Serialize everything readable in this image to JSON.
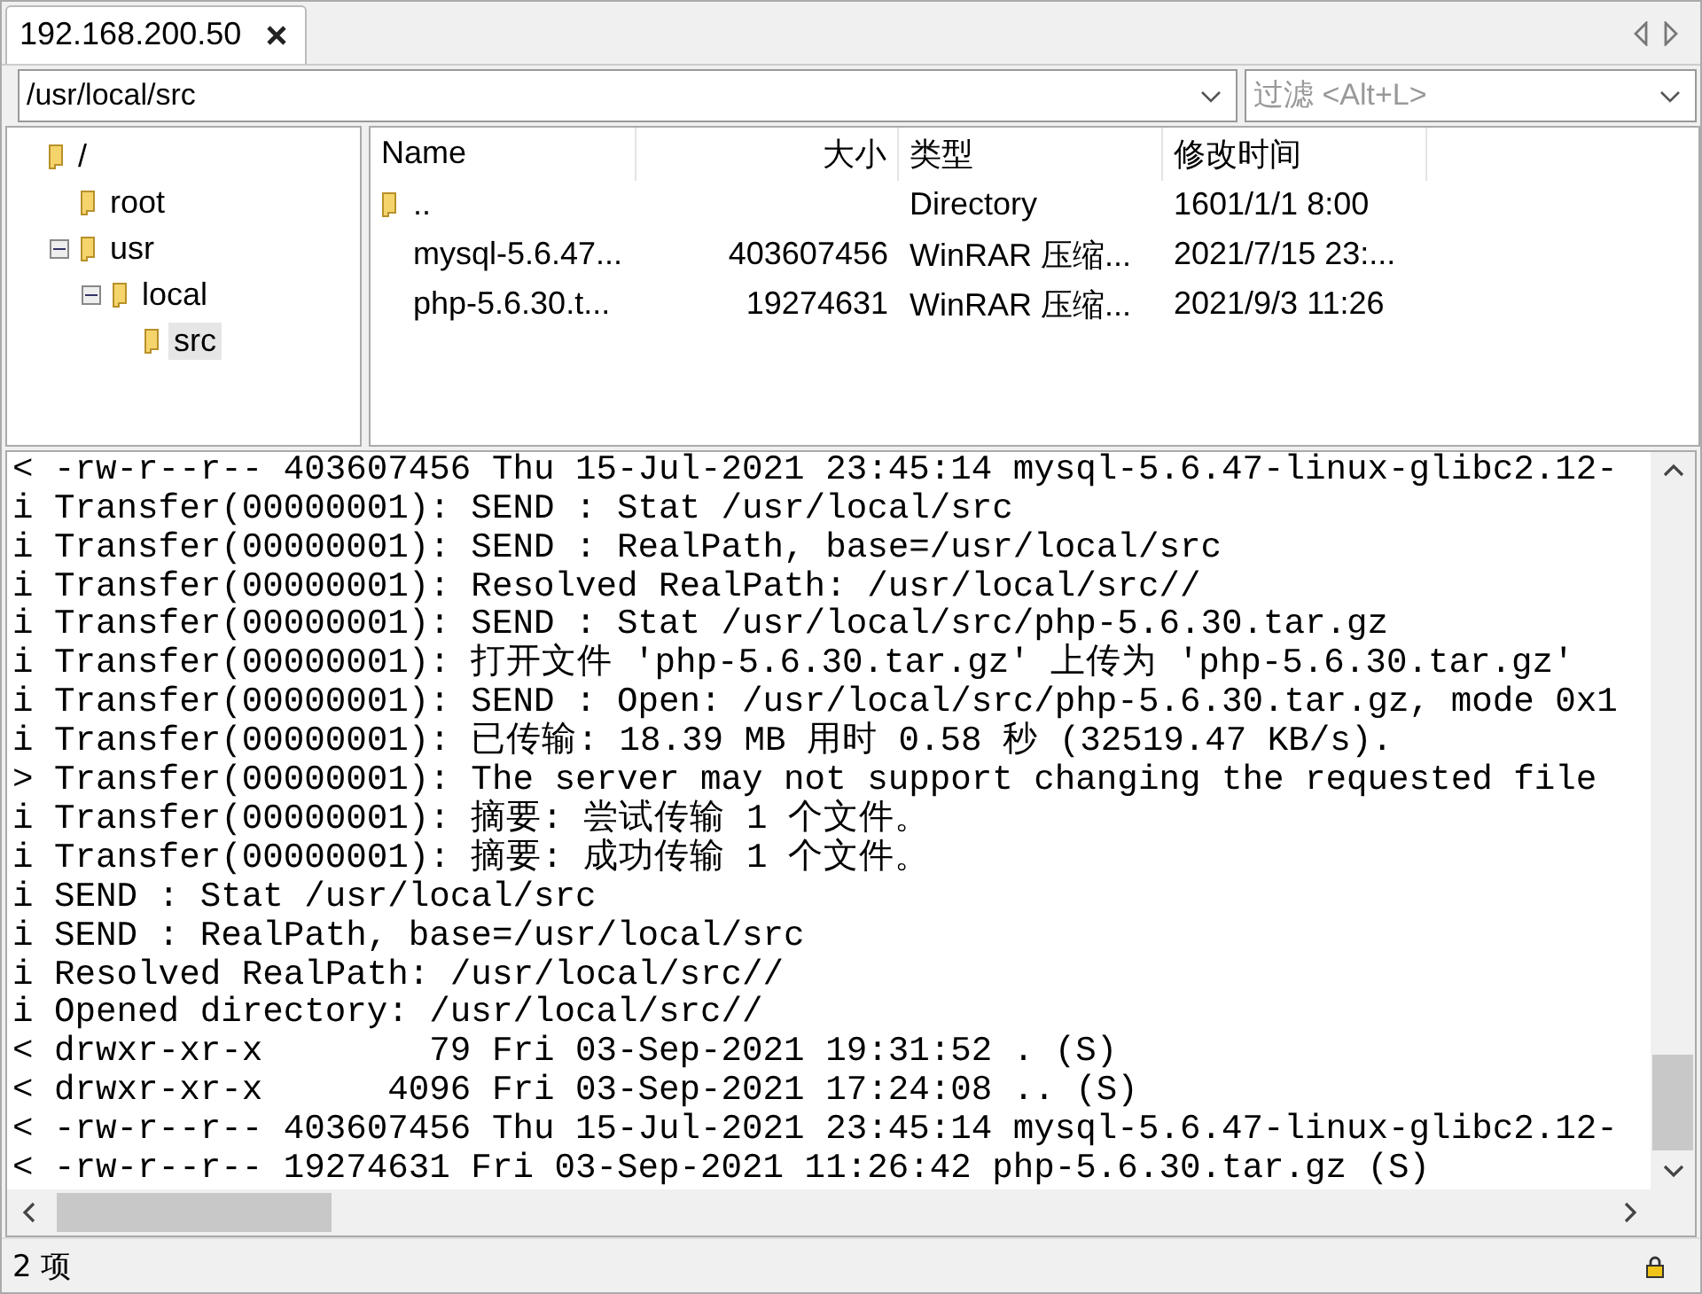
{
  "tabs": [
    {
      "label": "192.168.200.50",
      "selected": true
    }
  ],
  "path_bar": {
    "value": "/usr/local/src"
  },
  "filter": {
    "placeholder": "过滤 <Alt+L>"
  },
  "tree": [
    {
      "label": "/",
      "selected": false,
      "children": [
        {
          "label": "root",
          "selected": false
        },
        {
          "label": "usr",
          "selected": false,
          "expanded": true,
          "children": [
            {
              "label": "local",
              "selected": false,
              "expanded": true,
              "children": [
                {
                  "label": "src",
                  "selected": true
                }
              ]
            }
          ]
        }
      ]
    }
  ],
  "file_list": {
    "columns": [
      "Name",
      "大小",
      "类型",
      "修改时间"
    ],
    "rows": [
      {
        "kind": "folder",
        "name": "..",
        "size": "",
        "type": "Directory",
        "modified": "1601/1/1 8:00"
      },
      {
        "kind": "file",
        "name": "mysql-5.6.47...",
        "size": "403607456",
        "type": "WinRAR 压缩...",
        "modified": "2021/7/15 23:..."
      },
      {
        "kind": "file",
        "name": "php-5.6.30.t...",
        "size": "19274631",
        "type": "WinRAR 压缩...",
        "modified": "2021/9/3 11:26"
      }
    ]
  },
  "log": [
    "< -rw-r--r-- 403607456 Thu 15-Jul-2021 23:45:14 mysql-5.6.47-linux-glibc2.12-",
    "i Transfer(00000001): SEND : Stat /usr/local/src",
    "i Transfer(00000001): SEND : RealPath, base=/usr/local/src",
    "i Transfer(00000001): Resolved RealPath: /usr/local/src//",
    "i Transfer(00000001): SEND : Stat /usr/local/src/php-5.6.30.tar.gz",
    "i Transfer(00000001): 打开文件 'php-5.6.30.tar.gz' 上传为 'php-5.6.30.tar.gz'",
    "i Transfer(00000001): SEND : Open: /usr/local/src/php-5.6.30.tar.gz, mode 0x1",
    "i Transfer(00000001): 已传输: 18.39 MB 用时 0.58 秒 (32519.47 KB/s).",
    "> Transfer(00000001): The server may not support changing the requested file",
    "i Transfer(00000001): 摘要: 尝试传输 1 个文件。",
    "i Transfer(00000001): 摘要: 成功传输 1 个文件。",
    "i SEND : Stat /usr/local/src",
    "i SEND : RealPath, base=/usr/local/src",
    "i Resolved RealPath: /usr/local/src//",
    "i Opened directory: /usr/local/src//",
    "< drwxr-xr-x        79 Fri 03-Sep-2021 19:31:52 . (S)",
    "< drwxr-xr-x      4096 Fri 03-Sep-2021 17:24:08 .. (S)",
    "< -rw-r--r-- 403607456 Thu 15-Jul-2021 23:45:14 mysql-5.6.47-linux-glibc2.12-",
    "< -rw-r--r-- 19274631 Fri 03-Sep-2021 11:26:42 php-5.6.30.tar.gz (S)"
  ],
  "status_bar": {
    "text": "2 项"
  }
}
